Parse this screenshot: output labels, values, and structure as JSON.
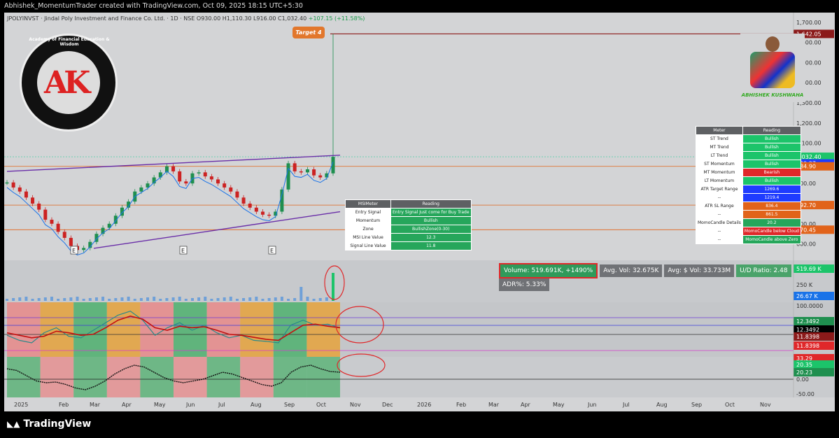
{
  "header": {
    "attribution": "Abhishek_MomentumTrader created with TradingView.com, Oct 09, 2025 18:15 UTC+5:30"
  },
  "symbol": {
    "text": "JPOLYINVST · Jindal Poly Investment and Finance Co. Ltd. · 1D · NSE",
    "open_l": "O",
    "open": "930.00",
    "high_l": "H",
    "high": "1,110.30",
    "low_l": "L",
    "low": "916.00",
    "close_l": "C",
    "close": "1,032.40",
    "change": "+107.15 (+11.58%)"
  },
  "logo": {
    "text": "AK",
    "ring_text": "Academy of Financial Education & Wisdom"
  },
  "author": {
    "name": "ABHISHEK KUSHWAHA"
  },
  "annotation": {
    "target": "Target 4"
  },
  "colors": {
    "bullish": "#1cc46a",
    "bearish": "#e0282a",
    "blue": "#1f3cff",
    "orange": "#e1631a",
    "green_cell": "#26a65b",
    "price_line": "#1a73e8",
    "resistance": "#8b1a1a",
    "trend": "#6a2fa8"
  },
  "chart_data": [
    {
      "type": "candlestick",
      "x_ticks": [
        "2025",
        "Feb",
        "Mar",
        "Apr",
        "May",
        "Jun",
        "Jul",
        "Aug",
        "Sep",
        "Oct",
        "Nov",
        "Dec",
        "2026",
        "Feb",
        "Mar",
        "Apr",
        "May",
        "Jun",
        "Jul",
        "Aug",
        "Sep",
        "Oct",
        "Nov"
      ],
      "y_ticks": [
        "1,700.00",
        "1,600.00",
        "1,500.00",
        "1,400.00",
        "1,300.00",
        "1,200.00",
        "1,100.00",
        "900.00",
        "700.00",
        "600.00"
      ],
      "ylim": [
        550,
        1720
      ],
      "close_series": [
        905,
        880,
        860,
        830,
        800,
        770,
        720,
        700,
        660,
        630,
        590,
        570,
        580,
        610,
        650,
        680,
        700,
        740,
        780,
        810,
        860,
        880,
        900,
        930,
        955,
        985,
        960,
        910,
        900,
        950,
        955,
        935,
        920,
        900,
        880,
        860,
        830,
        800,
        780,
        760,
        745,
        740,
        760,
        870,
        1000,
        960,
        955,
        970,
        940,
        930,
        950,
        1032
      ],
      "high_last": 1642,
      "price_labels": [
        {
          "v": 1642.05,
          "t": "1,642.05",
          "c": "#8b1a1a"
        },
        {
          "v": 1032.4,
          "t": "1,032.40",
          "c": "#1cc46a"
        },
        {
          "v": 999.27,
          "t": "999.27",
          "c": "#1f3cff"
        },
        {
          "v": 984.9,
          "t": "984.90",
          "c": "#e1631a"
        },
        {
          "v": 792.7,
          "t": "792.70",
          "c": "#e1631a"
        },
        {
          "v": 670.45,
          "t": "670.45",
          "c": "#e1631a"
        }
      ],
      "e_markers": [
        "E",
        "E",
        "E"
      ]
    },
    {
      "type": "bar",
      "name": "volume",
      "y_ticks": [
        "250 K"
      ],
      "labels": [
        {
          "t": "519.69 K",
          "c": "#1cc46a"
        },
        {
          "t": "26.67 K",
          "c": "#1a73e8"
        }
      ]
    },
    {
      "type": "line",
      "name": "msi",
      "y_ticks": [
        "100.0000"
      ],
      "labels": [
        {
          "t": "12.3492",
          "c": "#1f8f4f"
        },
        {
          "t": "12.3492",
          "c": "#000"
        },
        {
          "t": "11.8398",
          "c": "#8b1a1a"
        },
        {
          "t": "11.8398",
          "c": "#e0282a"
        }
      ],
      "series": [
        {
          "values": [
            40,
            30,
            25,
            45,
            55,
            38,
            35,
            50,
            65,
            80,
            88,
            70,
            40,
            55,
            65,
            50,
            60,
            45,
            35,
            40,
            30,
            28,
            25,
            60,
            70,
            60,
            62,
            55
          ]
        },
        {
          "values": [
            45,
            40,
            35,
            38,
            48,
            45,
            40,
            42,
            55,
            70,
            78,
            72,
            55,
            50,
            58,
            55,
            57,
            50,
            42,
            40,
            36,
            32,
            30,
            45,
            60,
            62,
            58,
            55
          ]
        }
      ]
    },
    {
      "type": "area",
      "name": "momocandle",
      "y_ticks": [
        "0.00",
        "-50.00"
      ],
      "labels": [
        {
          "t": "33.29",
          "c": "#e0282a"
        },
        {
          "t": "20.35",
          "c": "#1cc46a"
        },
        {
          "t": "20.23",
          "c": "#1f8f4f"
        }
      ],
      "values": [
        30,
        25,
        10,
        -5,
        -10,
        -8,
        -15,
        -25,
        -30,
        -20,
        -5,
        15,
        30,
        40,
        35,
        20,
        5,
        -5,
        -10,
        -5,
        0,
        10,
        20,
        15,
        5,
        -5,
        -15,
        -20,
        -10,
        20,
        35,
        40,
        30,
        22,
        20
      ]
    }
  ],
  "volume_stats": {
    "volume": "Volume: 519.691K, +1490%",
    "avg_vol": "Avg. Vol: 32.675K",
    "avg_dollar": "Avg: $ Vol: 33.733M",
    "ud_ratio": "U/D Ratio: 2.48",
    "adr": "ADR%: 5.33%"
  },
  "msi_table": {
    "headers": [
      "MSIMeter",
      "Reading"
    ],
    "rows": [
      [
        "Entry Signal",
        "Entry Signal Just come for Buy Trade",
        "#26a65b"
      ],
      [
        "Momentum",
        "Bullish",
        "#26a65b"
      ],
      [
        "Zone",
        "BullishZone(0-30)",
        "#26a65b"
      ],
      [
        "MSI Line Value",
        "12.3",
        "#26a65b"
      ],
      [
        "Signal Line Value",
        "11.8",
        "#26a65b"
      ]
    ]
  },
  "meter_table": {
    "headers": [
      "Meter",
      "Reading"
    ],
    "rows": [
      [
        "ST Trend",
        "Bullish",
        "#1cc46a"
      ],
      [
        "MT Trend",
        "Bullish",
        "#1cc46a"
      ],
      [
        "LT Trend",
        "Bullish",
        "#1cc46a"
      ],
      [
        "ST Momentum",
        "Bullish",
        "#1cc46a"
      ],
      [
        "MT Momentum",
        "Bearish",
        "#e0282a"
      ],
      [
        "LT Momentum",
        "Bullish",
        "#1cc46a"
      ],
      [
        "ATR Target Range",
        "1269.6",
        "#1f3cff"
      ],
      [
        "--",
        "1219.4",
        "#1f3cff"
      ],
      [
        "ATR SL Range",
        "836.4",
        "#e1631a"
      ],
      [
        "--",
        "861.5",
        "#e1631a"
      ],
      [
        "MomoCandle Details",
        "20.2",
        "#26a65b"
      ],
      [
        "--",
        "MomoCandle below Cloud",
        "#e0282a"
      ],
      [
        "--",
        "MomoCandle above Zero",
        "#26a65b"
      ]
    ]
  },
  "footer": {
    "brand": "TradingView"
  }
}
